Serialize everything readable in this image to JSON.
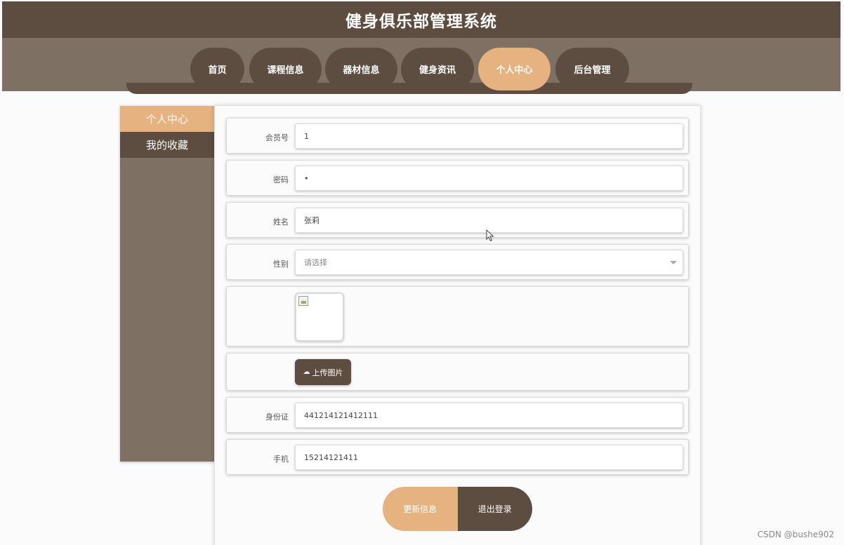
{
  "header": {
    "title": "健身俱乐部管理系统"
  },
  "nav": {
    "items": [
      {
        "label": "首页"
      },
      {
        "label": "课程信息"
      },
      {
        "label": "器材信息"
      },
      {
        "label": "健身资讯"
      },
      {
        "label": "个人中心",
        "active": true
      },
      {
        "label": "后台管理"
      }
    ]
  },
  "sidebar": {
    "items": [
      {
        "label": "个人中心",
        "active": true
      },
      {
        "label": "我的收藏"
      }
    ]
  },
  "form": {
    "member_no": {
      "label": "会员号",
      "value": "1"
    },
    "password": {
      "label": "密码",
      "value": "•"
    },
    "name": {
      "label": "姓名",
      "value": "张莉"
    },
    "gender": {
      "label": "性别",
      "placeholder": "请选择"
    },
    "upload": {
      "label": "上传图片"
    },
    "id_card": {
      "label": "身份证",
      "value": "441214121412111"
    },
    "phone": {
      "label": "手机",
      "value": "15214121411"
    }
  },
  "actions": {
    "update_label": "更新信息",
    "logout_label": "退出登录"
  },
  "watermark": "CSDN @bushe902",
  "colors": {
    "dark_brown": "#5d4d40",
    "mid_brown": "#7e7062",
    "accent": "#e6b27f"
  }
}
